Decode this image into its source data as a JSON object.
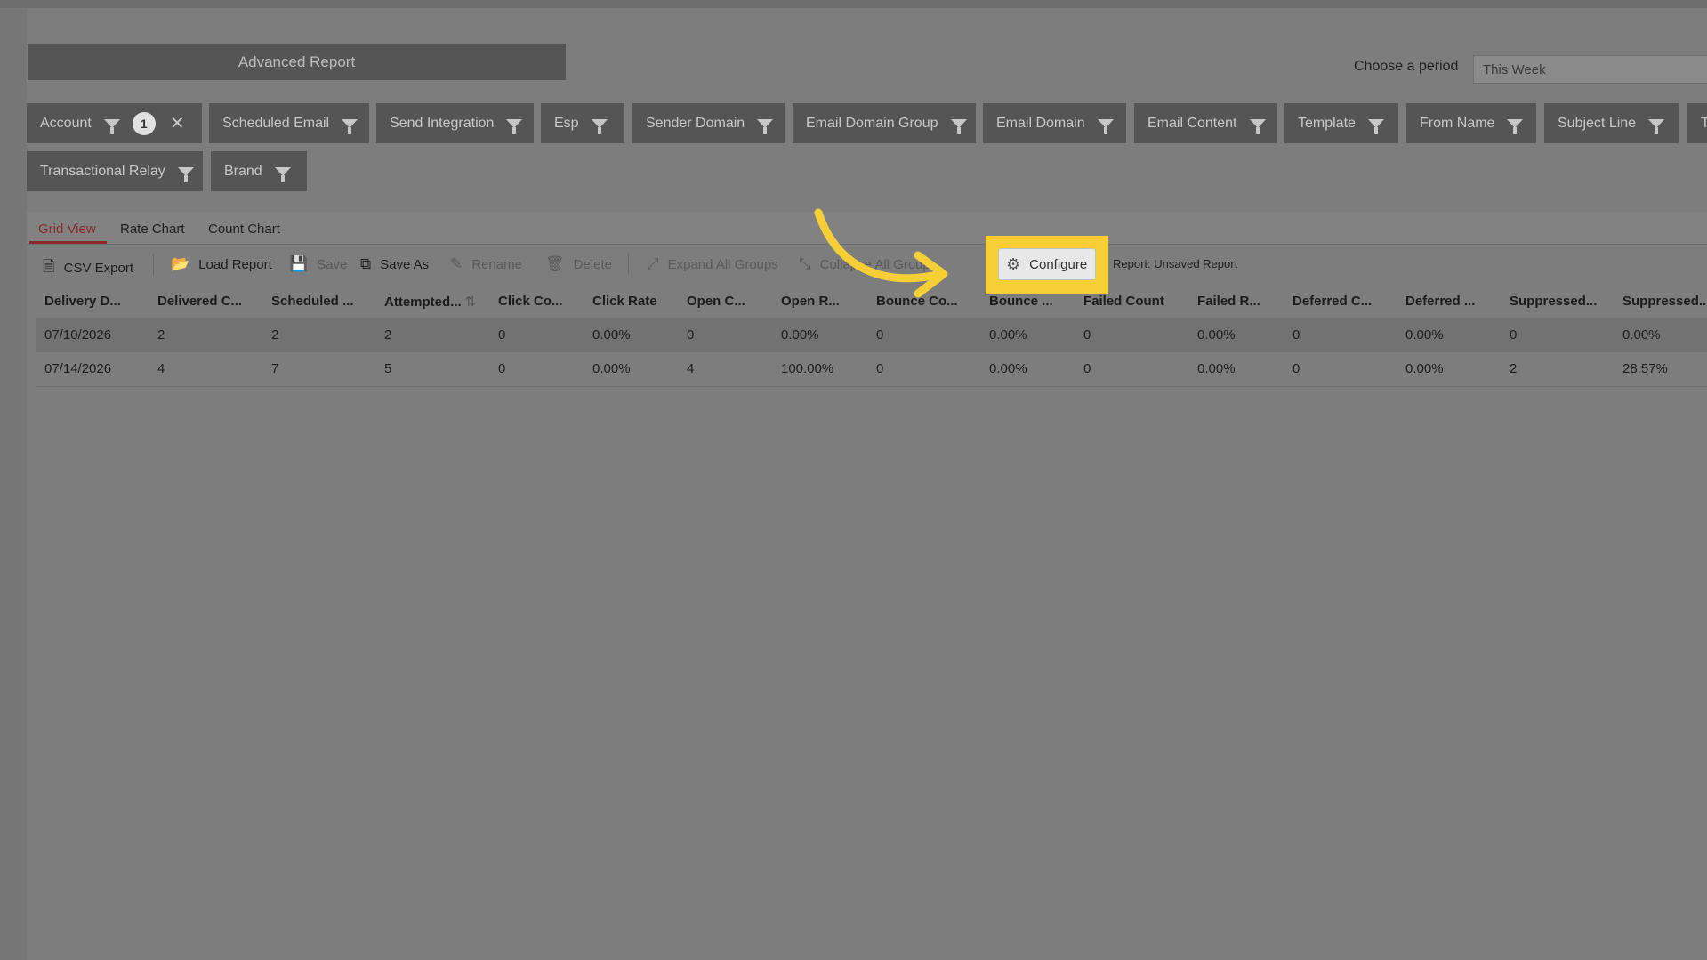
{
  "title": "Advanced Report",
  "period": {
    "label": "Choose a period",
    "value": "This Week"
  },
  "filters": [
    {
      "label": "Account",
      "count": "1"
    },
    {
      "label": "Scheduled Email"
    },
    {
      "label": "Send Integration"
    },
    {
      "label": "Esp"
    },
    {
      "label": "Sender Domain"
    },
    {
      "label": "Email Domain Group"
    },
    {
      "label": "Email Domain"
    },
    {
      "label": "Email Content"
    },
    {
      "label": "Template"
    },
    {
      "label": "From Name"
    },
    {
      "label": "Subject Line"
    },
    {
      "label": "T"
    },
    {
      "label": "Transactional Relay"
    },
    {
      "label": "Brand"
    }
  ],
  "tabs": [
    "Grid View",
    "Rate Chart",
    "Count Chart"
  ],
  "toolbar": {
    "csv_export": "CSV Export",
    "load_report": "Load Report",
    "save": "Save",
    "save_as": "Save As",
    "rename": "Rename",
    "delete": "Delete",
    "expand_all": "Expand All Groups",
    "collapse_all": "Collapse All Groups",
    "configure": "Configure",
    "report_name": "Report: Unsaved Report"
  },
  "highlight_color": "#f6cf37",
  "columns": [
    "Delivery D...",
    "Delivered C...",
    "Scheduled ...",
    "Attempted...",
    "Click Co...",
    "Click Rate",
    "Open C...",
    "Open R...",
    "Bounce Co...",
    "Bounce ...",
    "Failed Count",
    "Failed R...",
    "Deferred C...",
    "Deferred ...",
    "Suppressed...",
    "Suppressed..."
  ],
  "rows": [
    [
      "07/10/2026",
      "2",
      "2",
      "2",
      "0",
      "0.00%",
      "0",
      "0.00%",
      "0",
      "0.00%",
      "0",
      "0.00%",
      "0",
      "0.00%",
      "0",
      "0.00%"
    ],
    [
      "07/14/2026",
      "4",
      "7",
      "5",
      "0",
      "0.00%",
      "4",
      "100.00%",
      "0",
      "0.00%",
      "0",
      "0.00%",
      "0",
      "0.00%",
      "2",
      "28.57%"
    ]
  ]
}
